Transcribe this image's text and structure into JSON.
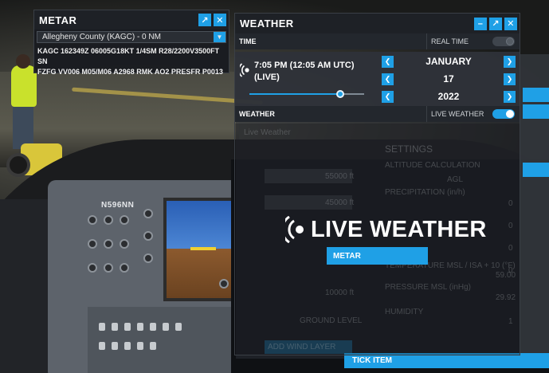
{
  "cockpit": {
    "tail_number": "N596NN"
  },
  "metar_window": {
    "title": "METAR",
    "station": "Allegheny County (KAGC) - 0 NM",
    "report_line1": "KAGC 162349Z 06005G18KT 1/4SM R28/2200V3500FT SN",
    "report_line2": "FZFG VV006 M05/M06 A2968 RMK AO2 PRESFR P0013"
  },
  "weather_window": {
    "title": "WEATHER",
    "time_section": {
      "header": "TIME",
      "real_time_label": "REAL TIME",
      "real_time_on": false,
      "time_line1": "7:05 PM (12:05 AM UTC)",
      "time_line2": "(LIVE)",
      "time_of_day_fraction": 0.79,
      "month": "JANUARY",
      "day": "17",
      "year": "2022"
    },
    "weather_section": {
      "header": "WEATHER",
      "live_weather_label": "LIVE WEATHER",
      "live_weather_on": true
    },
    "overlay": {
      "live_weather_banner": "LIVE WEATHER",
      "metar_button": "METAR"
    }
  },
  "background_panel": {
    "preset": "Live Weather",
    "settings_title": "SETTINGS",
    "altitude_calc_label": "ALTITUDE CALCULATION",
    "altitude_calc_value": "AGL",
    "precipitation_label": "PRECIPITATION (in/h)",
    "precipitation_value": "0",
    "row_value_2": "0",
    "row_value_3": "0",
    "row_value_4": "0",
    "temperature_label": "TEMPERATURE MSL / ISA + 10 (°F)",
    "temperature_value": "59.00",
    "pressure_label": "PRESSURE MSL (inHg)",
    "pressure_value": "29.92",
    "humidity_label": "HUMIDITY",
    "humidity_value": "1",
    "layer_alt_1": "55000 ft",
    "layer_alt_2": "45000 ft",
    "layer_alt_3": "10000 ft",
    "ground_level": "GROUND LEVEL",
    "add_wind_layer": "ADD WIND LAYER",
    "tick_item": "TICK ITEM"
  },
  "colors": {
    "accent": "#1fa0e6",
    "toggle_off": "#3f454d"
  }
}
